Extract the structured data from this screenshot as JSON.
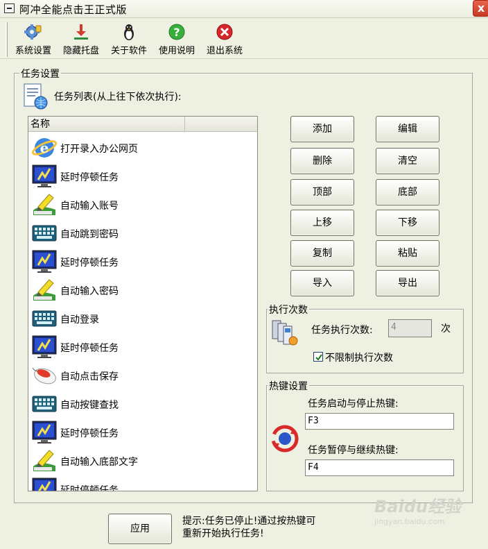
{
  "window": {
    "title": "阿冲全能点击王正式版",
    "close_label": "x"
  },
  "toolbar": {
    "items": [
      {
        "label": "系统设置",
        "icon": "settings-icon"
      },
      {
        "label": "隐藏托盘",
        "icon": "tray-icon"
      },
      {
        "label": "关于软件",
        "icon": "about-icon"
      },
      {
        "label": "使用说明",
        "icon": "help-icon"
      },
      {
        "label": "退出系统",
        "icon": "exit-icon"
      }
    ]
  },
  "task_settings": {
    "group_label": "任务设置",
    "list_title": "任务列表(从上往下依次执行):",
    "column_header": "名称",
    "tasks": [
      {
        "label": "打开录入办公网页",
        "icon": "ie-icon"
      },
      {
        "label": "延时停顿任务",
        "icon": "monitor-delay-icon"
      },
      {
        "label": "自动输入账号",
        "icon": "pen-input-icon"
      },
      {
        "label": "自动跳到密码",
        "icon": "keyboard-icon"
      },
      {
        "label": "延时停顿任务",
        "icon": "monitor-delay-icon"
      },
      {
        "label": "自动输入密码",
        "icon": "pen-input-icon"
      },
      {
        "label": "自动登录",
        "icon": "keyboard-icon"
      },
      {
        "label": "延时停顿任务",
        "icon": "monitor-delay-icon"
      },
      {
        "label": "自动点击保存",
        "icon": "mouse-icon"
      },
      {
        "label": "自动按键查找",
        "icon": "keyboard-icon"
      },
      {
        "label": "延时停顿任务",
        "icon": "monitor-delay-icon"
      },
      {
        "label": "自动输入底部文字",
        "icon": "pen-input-icon"
      },
      {
        "label": "延时停顿任务",
        "icon": "monitor-delay-icon"
      }
    ],
    "buttons": {
      "add": "添加",
      "edit": "编辑",
      "delete": "删除",
      "clear": "清空",
      "top": "顶部",
      "bottom": "底部",
      "up": "上移",
      "down": "下移",
      "copy": "复制",
      "paste": "粘贴",
      "import": "导入",
      "export": "导出"
    }
  },
  "exec_count": {
    "group_label": "执行次数",
    "label": "任务执行次数:",
    "value": "4",
    "unit": "次",
    "unlimited_label": "不限制执行次数",
    "unlimited_checked": true
  },
  "hotkeys": {
    "group_label": "热键设置",
    "start_stop_label": "任务启动与停止热键:",
    "start_stop_value": "F3",
    "pause_resume_label": "任务暂停与继续热键:",
    "pause_resume_value": "F4"
  },
  "footer": {
    "apply_label": "应用",
    "hint_line1": "提示:任务已停止!通过按热键可",
    "hint_line2": "重新开始执行任务!"
  },
  "watermark": {
    "brand": "Baidu经验",
    "url": "jingyan.baidu.com"
  }
}
